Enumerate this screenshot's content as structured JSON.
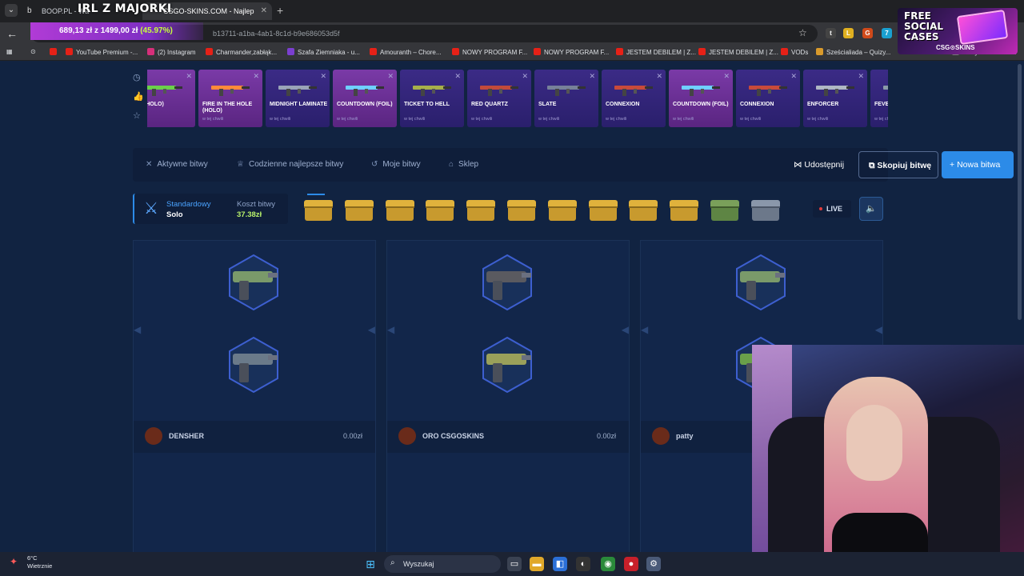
{
  "browser": {
    "tabs": [
      {
        "label": "BOOP.PL - Wa"
      },
      {
        "label": "CSGO-SKINS.COM - Najlep"
      }
    ],
    "overlay_title": "IRL Z MAJORKI",
    "url_fragment": "b13711-a1ba-4ab1-8c1d-b9e686053d5f",
    "promo": {
      "current": "689,13 zł",
      "sep": "z",
      "target": "1499,00 zł",
      "percent": "(45.97%)"
    },
    "bookmarks": [
      "YouTube Premium -...",
      "(2) Instagram",
      "Charmander,zabłąk...",
      "Szafa Ziemniaka - u...",
      "Amouranth – Chore...",
      "NOWY PROGRAM F...",
      "NOWY PROGRAM F...",
      "JESTEM DEBILEM | Z...",
      "JESTEM DEBILEM | Z...",
      "VODs",
      "Sześcialiada – Quizy..."
    ],
    "bookmarks_extra": "Wszystkie zakładki"
  },
  "promo_banner": {
    "line1": "FREE",
    "line2": "SOCIAL",
    "line3": "CASES",
    "brand": "CSG⊙SKINS"
  },
  "drops": [
    {
      "name": "AY (HOLO)",
      "when": "",
      "style": "pink"
    },
    {
      "name": "FIRE IN THE HOLE (HOLO)",
      "when": "w tej chwili",
      "style": "pink"
    },
    {
      "name": "MIDNIGHT LAMINATE",
      "when": "w tej chwili",
      "style": "blue"
    },
    {
      "name": "COUNTDOWN (FOIL)",
      "when": "w tej chwili",
      "style": "pink"
    },
    {
      "name": "TICKET TO HELL",
      "when": "w tej chwili",
      "style": "blue"
    },
    {
      "name": "RED QUARTZ",
      "when": "w tej chwili",
      "style": "blue"
    },
    {
      "name": "SLATE",
      "when": "w tej chwili",
      "style": "blue"
    },
    {
      "name": "CONNEXION",
      "when": "w tej chwili",
      "style": "blue"
    },
    {
      "name": "COUNTDOWN (FOIL)",
      "when": "w tej chwili",
      "style": "pink"
    },
    {
      "name": "CONNEXION",
      "when": "w tej chwili",
      "style": "blue"
    },
    {
      "name": "ENFORCER",
      "when": "w tej chwili",
      "style": "blue"
    },
    {
      "name": "FEVER DR",
      "when": "w tej chwili",
      "style": "blue"
    }
  ],
  "menu": {
    "active_battles": "Aktywne bitwy",
    "daily_best": "Codzienne najlepsze bitwy",
    "my_battles": "Moje bitwy",
    "shop": "Sklep",
    "share": "Udostępnij",
    "copy": "Skopiuj bitwę",
    "new": "Nowa bitwa"
  },
  "battle": {
    "mode_label": "Standardowy",
    "mode_value": "Solo",
    "cost_label": "Koszt bitwy",
    "cost_value": "37.38zł",
    "live": "LIVE",
    "case_colors": [
      "gold",
      "gold",
      "gold",
      "gold",
      "gold",
      "gold",
      "gold",
      "gold",
      "gold",
      "gold",
      "green",
      "grey"
    ]
  },
  "players": [
    {
      "name": "DENSHER",
      "value": "0.00zł"
    },
    {
      "name": "ORO CSGOSKINS",
      "value": "0.00zł"
    },
    {
      "name": "patty",
      "value": ""
    }
  ],
  "taskbar": {
    "temp": "6°C",
    "weather": "Wietrznie",
    "search": "Wyszukaj"
  }
}
